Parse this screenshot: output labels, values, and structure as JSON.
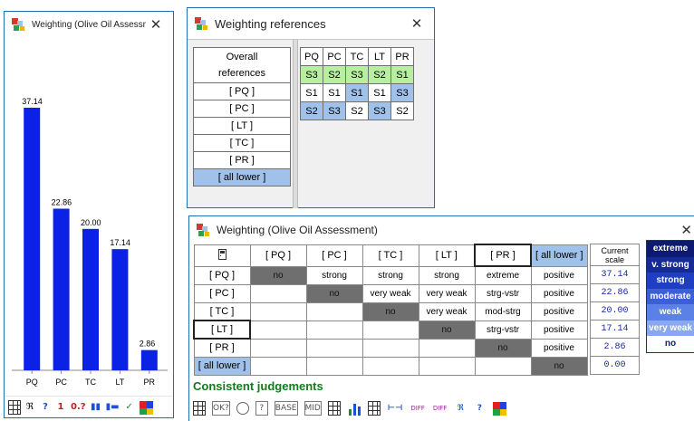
{
  "chart_window": {
    "title": "Weighting (Olive Oil Assessm...",
    "close": "✕",
    "toolbar": [
      "▦",
      "ℜ",
      "?",
      "1",
      "0.?",
      "▮▮",
      "▮▬",
      "✓",
      "■"
    ]
  },
  "chart_data": {
    "type": "bar",
    "categories": [
      "PQ",
      "PC",
      "TC",
      "LT",
      "PR"
    ],
    "values": [
      37.14,
      22.86,
      20.0,
      17.14,
      2.86
    ],
    "labels": [
      "37.14",
      "22.86",
      "20.00",
      "17.14",
      "2.86"
    ],
    "title": "",
    "xlabel": "",
    "ylabel": "",
    "ylim": [
      0,
      40
    ],
    "bar_color": "#0b22e6",
    "grid": false
  },
  "references_window": {
    "title": "Weighting references",
    "close": "✕",
    "left_items": [
      "Overall",
      "references",
      "[ PQ ]",
      "[ PC ]",
      "[ LT ]",
      "[ TC ]",
      "[ PR ]",
      "[ all lower ]"
    ],
    "columns": [
      "PQ",
      "PC",
      "TC",
      "LT",
      "PR"
    ],
    "rows": [
      [
        {
          "v": "S3",
          "c": "g"
        },
        {
          "v": "S2",
          "c": "g"
        },
        {
          "v": "S3",
          "c": "g"
        },
        {
          "v": "S2",
          "c": "g"
        },
        {
          "v": "S1",
          "c": "g"
        }
      ],
      [
        {
          "v": "S1",
          "c": ""
        },
        {
          "v": "S1",
          "c": ""
        },
        {
          "v": "S1",
          "c": "b"
        },
        {
          "v": "S1",
          "c": ""
        },
        {
          "v": "S3",
          "c": "b"
        }
      ],
      [
        {
          "v": "S2",
          "c": "b"
        },
        {
          "v": "S3",
          "c": "b"
        },
        {
          "v": "S2",
          "c": ""
        },
        {
          "v": "S3",
          "c": "b"
        },
        {
          "v": "S2",
          "c": ""
        }
      ]
    ]
  },
  "matrix_window": {
    "title": "Weighting (Olive Oil Assessment)",
    "close": "✕",
    "col_headers": [
      "[ PQ ]",
      "[ PC ]",
      "[ TC ]",
      "[ LT ]",
      "[ PR ]",
      "[ all lower ]"
    ],
    "row_headers": [
      "[ PQ ]",
      "[ PC ]",
      "[ TC ]",
      "[ LT ]",
      "[ PR ]",
      "[ all lower ]"
    ],
    "cells": [
      [
        "no",
        "strong",
        "strong",
        "strong",
        "extreme",
        "positive"
      ],
      [
        "",
        "no",
        "very weak",
        "very weak",
        "strg-vstr",
        "positive"
      ],
      [
        "",
        "",
        "no",
        "very weak",
        "mod-strg",
        "positive"
      ],
      [
        "",
        "",
        "",
        "no",
        "strg-vstr",
        "positive"
      ],
      [
        "",
        "",
        "",
        "",
        "no",
        "positive"
      ],
      [
        "",
        "",
        "",
        "",
        "",
        "no"
      ]
    ],
    "scale_header": [
      "Current",
      "scale"
    ],
    "scale_values": [
      "37.14",
      "22.86",
      "20.00",
      "17.14",
      "2.86",
      "0.00"
    ],
    "legend": [
      {
        "label": "extreme",
        "color": "#0d1a73"
      },
      {
        "label": "v. strong",
        "color": "#162a96"
      },
      {
        "label": "strong",
        "color": "#1f3fc0"
      },
      {
        "label": "moderate",
        "color": "#3a5fd8"
      },
      {
        "label": "weak",
        "color": "#5b80e6"
      },
      {
        "label": "very weak",
        "color": "#8aa8ef"
      },
      {
        "label": "no",
        "color": "#ffffff"
      }
    ],
    "status": "Consistent judgements",
    "toolbar": [
      "OK?",
      "BASE",
      "MID",
      "DIFF",
      "DIFF",
      "?"
    ]
  }
}
